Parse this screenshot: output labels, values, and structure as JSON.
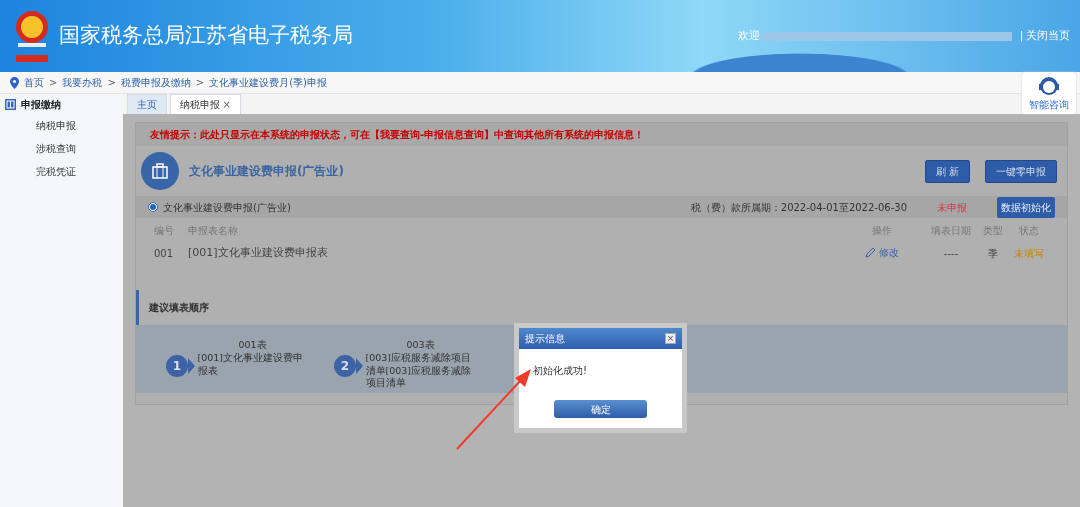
{
  "header": {
    "title": "国家税务总局江苏省电子税务局",
    "welcome": "欢迎",
    "divider": "|",
    "close_page": "关闭当页"
  },
  "breadcrumb_separator": ">",
  "breadcrumb": [
    "首页",
    "我要办税",
    "税费申报及缴纳",
    "文化事业建设费月(季)申报"
  ],
  "help": {
    "label": "智能咨询"
  },
  "sidebar": {
    "heading": "申报缴纳",
    "items": [
      "纳税申报",
      "涉税查询",
      "完税凭证"
    ]
  },
  "tabs": [
    {
      "label": "主页",
      "selected": false,
      "closable": false
    },
    {
      "label": "纳税申报",
      "selected": true,
      "closable": true
    }
  ],
  "close_mark": "×",
  "notice": "友情提示：此处只显示在本系统的申报状态，可在【我要查询-申报信息查询】中查询其他所有系统的申报信息！",
  "form_panel": {
    "title": "文化事业建设费申报(广告业)",
    "buttons": [
      "刷 新",
      "一键零申报"
    ]
  },
  "declaration": {
    "name": "文化事业建设费申报(广告业)",
    "selected": true,
    "period": "税（费）款所属期：2022-04-01至2022-06-30",
    "status": "未申报",
    "init_button": "数据初始化"
  },
  "table": {
    "columns": [
      "编号",
      "申报表名称",
      "操作",
      "填表日期",
      "类型",
      "状态"
    ],
    "rows": [
      {
        "number": "001",
        "name": "[001]文化事业建设费申报表",
        "action": "修改",
        "date": "----",
        "type": "季",
        "status": "未填写"
      }
    ]
  },
  "order": {
    "title": "建议填表顺序",
    "steps": [
      {
        "number": "1",
        "code": "001表",
        "name": "[001]文化事业建设费申报表"
      },
      {
        "number": "2",
        "code": "003表",
        "name": "[003]应税服务减除项目清单[003]应税服务减除项目清单"
      }
    ]
  },
  "dialog": {
    "title": "提示信息",
    "message": "初始化成功!",
    "ok": "确定",
    "close": "×"
  }
}
